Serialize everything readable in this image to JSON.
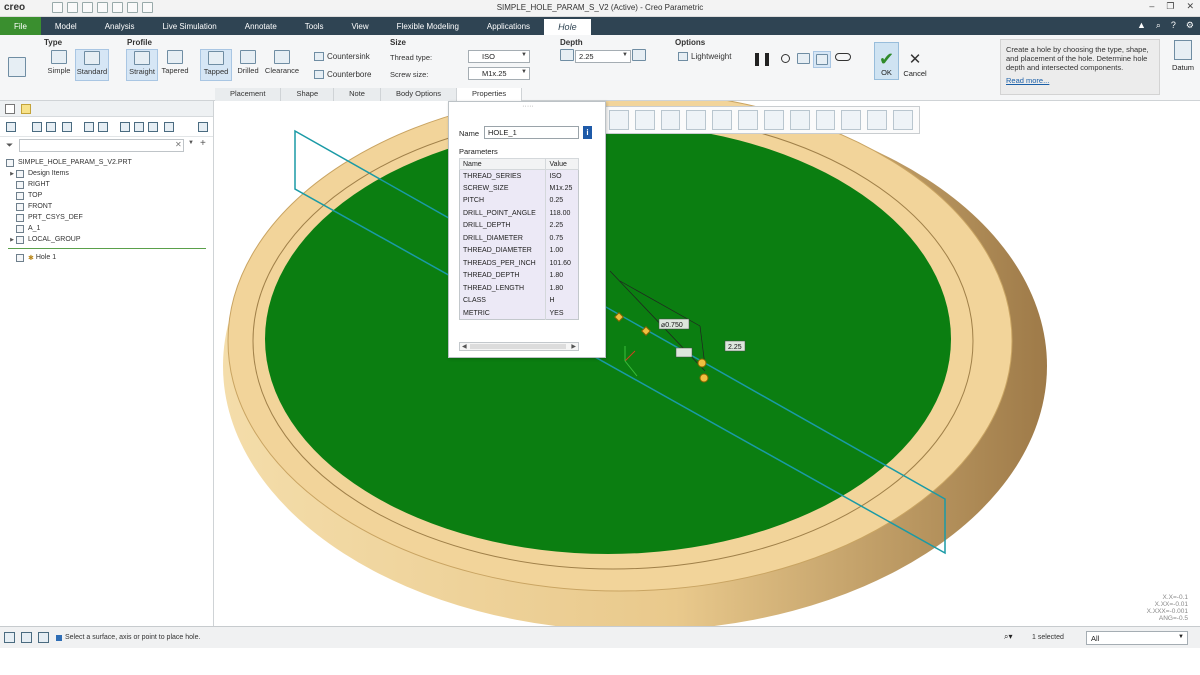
{
  "titlebar": {
    "app_logo": "creo",
    "window_title": "SIMPLE_HOLE_PARAM_S_V2 (Active) - Creo Parametric"
  },
  "tabs": [
    {
      "label": "File"
    },
    {
      "label": "Model"
    },
    {
      "label": "Analysis"
    },
    {
      "label": "Live Simulation"
    },
    {
      "label": "Annotate"
    },
    {
      "label": "Tools"
    },
    {
      "label": "View"
    },
    {
      "label": "Flexible Modeling"
    },
    {
      "label": "Applications"
    },
    {
      "label": "Hole"
    }
  ],
  "ribbon": {
    "type_title": "Type",
    "simple_label": "Simple",
    "standard_label": "Standard",
    "profile_title": "Profile",
    "straight_label": "Straight",
    "tapered_label": "Tapered",
    "tapped_label": "Tapped",
    "drilled_label": "Drilled",
    "clearance_label": "Clearance",
    "countersink_label": "Countersink",
    "counterbore_label": "Counterbore",
    "size_title": "Size",
    "thread_type_label": "Thread type:",
    "thread_type_value": "ISO",
    "screw_size_label": "Screw size:",
    "screw_size_value": "M1x.25",
    "depth_title": "Depth",
    "depth_value": "2.25",
    "options_title": "Options",
    "lightweight_label": "Lightweight",
    "ok_label": "OK",
    "cancel_label": "Cancel",
    "help_text": "Create a hole by choosing the type, shape, and placement of the hole. Determine hole depth and intersected components.",
    "read_more": "Read more...",
    "datum_label": "Datum"
  },
  "subtabs": [
    "Placement",
    "Shape",
    "Note",
    "Body Options",
    "Properties"
  ],
  "tree": {
    "root": "SIMPLE_HOLE_PARAM_S_V2.PRT",
    "items": [
      {
        "label": "Design Items"
      },
      {
        "label": "RIGHT"
      },
      {
        "label": "TOP"
      },
      {
        "label": "FRONT"
      },
      {
        "label": "PRT_CSYS_DEF"
      },
      {
        "label": "A_1"
      },
      {
        "label": "LOCAL_GROUP"
      }
    ],
    "insert_item": "Hole 1"
  },
  "properties": {
    "name_label": "Name",
    "name_value": "HOLE_1",
    "parameters_title": "Parameters",
    "col_name": "Name",
    "col_value": "Value",
    "rows": [
      {
        "name": "THREAD_SERIES",
        "value": "ISO"
      },
      {
        "name": "SCREW_SIZE",
        "value": "M1x.25"
      },
      {
        "name": "PITCH",
        "value": "0.25"
      },
      {
        "name": "DRILL_POINT_ANGLE",
        "value": "118.00"
      },
      {
        "name": "DRILL_DEPTH",
        "value": "2.25"
      },
      {
        "name": "DRILL_DIAMETER",
        "value": "0.75"
      },
      {
        "name": "THREAD_DIAMETER",
        "value": "1.00"
      },
      {
        "name": "THREADS_PER_INCH",
        "value": "101.60"
      },
      {
        "name": "THREAD_DEPTH",
        "value": "1.80"
      },
      {
        "name": "THREAD_LENGTH",
        "value": "1.80"
      },
      {
        "name": "CLASS",
        "value": "H"
      },
      {
        "name": "METRIC",
        "value": "YES"
      }
    ]
  },
  "viewport": {
    "dim_diameter": "⌀0.750",
    "dim_depth": "2.25",
    "coords": [
      "X.X=-0.1",
      "X.XX=-0.01",
      "X.XXX=-0.001",
      "ANG=-0.5"
    ],
    "colors": {
      "top_face": "#0b7e11",
      "rim": "#f2d49a",
      "side": "#c6a26a",
      "plane": "#1a9aa6"
    }
  },
  "status": {
    "message": "Select a surface, axis or point to place hole.",
    "selected": "1 selected",
    "filter": "All"
  }
}
